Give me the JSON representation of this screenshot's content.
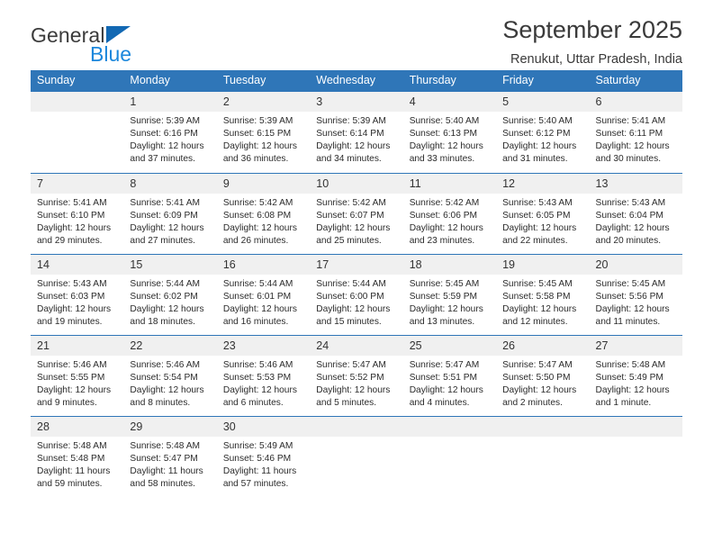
{
  "brand": {
    "name_part1": "General",
    "name_part2": "Blue"
  },
  "header": {
    "title": "September 2025",
    "subtitle": "Renukut, Uttar Pradesh, India"
  },
  "colors": {
    "header_blue": "#2f76b8",
    "brand_blue": "#1b87dc",
    "triangle_blue": "#1268b3",
    "daynum_band": "#f0f0f0",
    "text": "#2b2b2b"
  },
  "weekday_headers": [
    "Sunday",
    "Monday",
    "Tuesday",
    "Wednesday",
    "Thursday",
    "Friday",
    "Saturday"
  ],
  "labels": {
    "sunrise_prefix": "Sunrise:",
    "sunset_prefix": "Sunset:",
    "daylight_prefix": "Daylight:"
  },
  "weeks": [
    [
      {
        "day": "",
        "sunrise": "",
        "sunset": "",
        "daylight_line1": "",
        "daylight_line2": ""
      },
      {
        "day": "1",
        "sunrise": "Sunrise: 5:39 AM",
        "sunset": "Sunset: 6:16 PM",
        "daylight_line1": "Daylight: 12 hours",
        "daylight_line2": "and 37 minutes."
      },
      {
        "day": "2",
        "sunrise": "Sunrise: 5:39 AM",
        "sunset": "Sunset: 6:15 PM",
        "daylight_line1": "Daylight: 12 hours",
        "daylight_line2": "and 36 minutes."
      },
      {
        "day": "3",
        "sunrise": "Sunrise: 5:39 AM",
        "sunset": "Sunset: 6:14 PM",
        "daylight_line1": "Daylight: 12 hours",
        "daylight_line2": "and 34 minutes."
      },
      {
        "day": "4",
        "sunrise": "Sunrise: 5:40 AM",
        "sunset": "Sunset: 6:13 PM",
        "daylight_line1": "Daylight: 12 hours",
        "daylight_line2": "and 33 minutes."
      },
      {
        "day": "5",
        "sunrise": "Sunrise: 5:40 AM",
        "sunset": "Sunset: 6:12 PM",
        "daylight_line1": "Daylight: 12 hours",
        "daylight_line2": "and 31 minutes."
      },
      {
        "day": "6",
        "sunrise": "Sunrise: 5:41 AM",
        "sunset": "Sunset: 6:11 PM",
        "daylight_line1": "Daylight: 12 hours",
        "daylight_line2": "and 30 minutes."
      }
    ],
    [
      {
        "day": "7",
        "sunrise": "Sunrise: 5:41 AM",
        "sunset": "Sunset: 6:10 PM",
        "daylight_line1": "Daylight: 12 hours",
        "daylight_line2": "and 29 minutes."
      },
      {
        "day": "8",
        "sunrise": "Sunrise: 5:41 AM",
        "sunset": "Sunset: 6:09 PM",
        "daylight_line1": "Daylight: 12 hours",
        "daylight_line2": "and 27 minutes."
      },
      {
        "day": "9",
        "sunrise": "Sunrise: 5:42 AM",
        "sunset": "Sunset: 6:08 PM",
        "daylight_line1": "Daylight: 12 hours",
        "daylight_line2": "and 26 minutes."
      },
      {
        "day": "10",
        "sunrise": "Sunrise: 5:42 AM",
        "sunset": "Sunset: 6:07 PM",
        "daylight_line1": "Daylight: 12 hours",
        "daylight_line2": "and 25 minutes."
      },
      {
        "day": "11",
        "sunrise": "Sunrise: 5:42 AM",
        "sunset": "Sunset: 6:06 PM",
        "daylight_line1": "Daylight: 12 hours",
        "daylight_line2": "and 23 minutes."
      },
      {
        "day": "12",
        "sunrise": "Sunrise: 5:43 AM",
        "sunset": "Sunset: 6:05 PM",
        "daylight_line1": "Daylight: 12 hours",
        "daylight_line2": "and 22 minutes."
      },
      {
        "day": "13",
        "sunrise": "Sunrise: 5:43 AM",
        "sunset": "Sunset: 6:04 PM",
        "daylight_line1": "Daylight: 12 hours",
        "daylight_line2": "and 20 minutes."
      }
    ],
    [
      {
        "day": "14",
        "sunrise": "Sunrise: 5:43 AM",
        "sunset": "Sunset: 6:03 PM",
        "daylight_line1": "Daylight: 12 hours",
        "daylight_line2": "and 19 minutes."
      },
      {
        "day": "15",
        "sunrise": "Sunrise: 5:44 AM",
        "sunset": "Sunset: 6:02 PM",
        "daylight_line1": "Daylight: 12 hours",
        "daylight_line2": "and 18 minutes."
      },
      {
        "day": "16",
        "sunrise": "Sunrise: 5:44 AM",
        "sunset": "Sunset: 6:01 PM",
        "daylight_line1": "Daylight: 12 hours",
        "daylight_line2": "and 16 minutes."
      },
      {
        "day": "17",
        "sunrise": "Sunrise: 5:44 AM",
        "sunset": "Sunset: 6:00 PM",
        "daylight_line1": "Daylight: 12 hours",
        "daylight_line2": "and 15 minutes."
      },
      {
        "day": "18",
        "sunrise": "Sunrise: 5:45 AM",
        "sunset": "Sunset: 5:59 PM",
        "daylight_line1": "Daylight: 12 hours",
        "daylight_line2": "and 13 minutes."
      },
      {
        "day": "19",
        "sunrise": "Sunrise: 5:45 AM",
        "sunset": "Sunset: 5:58 PM",
        "daylight_line1": "Daylight: 12 hours",
        "daylight_line2": "and 12 minutes."
      },
      {
        "day": "20",
        "sunrise": "Sunrise: 5:45 AM",
        "sunset": "Sunset: 5:56 PM",
        "daylight_line1": "Daylight: 12 hours",
        "daylight_line2": "and 11 minutes."
      }
    ],
    [
      {
        "day": "21",
        "sunrise": "Sunrise: 5:46 AM",
        "sunset": "Sunset: 5:55 PM",
        "daylight_line1": "Daylight: 12 hours",
        "daylight_line2": "and 9 minutes."
      },
      {
        "day": "22",
        "sunrise": "Sunrise: 5:46 AM",
        "sunset": "Sunset: 5:54 PM",
        "daylight_line1": "Daylight: 12 hours",
        "daylight_line2": "and 8 minutes."
      },
      {
        "day": "23",
        "sunrise": "Sunrise: 5:46 AM",
        "sunset": "Sunset: 5:53 PM",
        "daylight_line1": "Daylight: 12 hours",
        "daylight_line2": "and 6 minutes."
      },
      {
        "day": "24",
        "sunrise": "Sunrise: 5:47 AM",
        "sunset": "Sunset: 5:52 PM",
        "daylight_line1": "Daylight: 12 hours",
        "daylight_line2": "and 5 minutes."
      },
      {
        "day": "25",
        "sunrise": "Sunrise: 5:47 AM",
        "sunset": "Sunset: 5:51 PM",
        "daylight_line1": "Daylight: 12 hours",
        "daylight_line2": "and 4 minutes."
      },
      {
        "day": "26",
        "sunrise": "Sunrise: 5:47 AM",
        "sunset": "Sunset: 5:50 PM",
        "daylight_line1": "Daylight: 12 hours",
        "daylight_line2": "and 2 minutes."
      },
      {
        "day": "27",
        "sunrise": "Sunrise: 5:48 AM",
        "sunset": "Sunset: 5:49 PM",
        "daylight_line1": "Daylight: 12 hours",
        "daylight_line2": "and 1 minute."
      }
    ],
    [
      {
        "day": "28",
        "sunrise": "Sunrise: 5:48 AM",
        "sunset": "Sunset: 5:48 PM",
        "daylight_line1": "Daylight: 11 hours",
        "daylight_line2": "and 59 minutes."
      },
      {
        "day": "29",
        "sunrise": "Sunrise: 5:48 AM",
        "sunset": "Sunset: 5:47 PM",
        "daylight_line1": "Daylight: 11 hours",
        "daylight_line2": "and 58 minutes."
      },
      {
        "day": "30",
        "sunrise": "Sunrise: 5:49 AM",
        "sunset": "Sunset: 5:46 PM",
        "daylight_line1": "Daylight: 11 hours",
        "daylight_line2": "and 57 minutes."
      },
      {
        "day": "",
        "sunrise": "",
        "sunset": "",
        "daylight_line1": "",
        "daylight_line2": ""
      },
      {
        "day": "",
        "sunrise": "",
        "sunset": "",
        "daylight_line1": "",
        "daylight_line2": ""
      },
      {
        "day": "",
        "sunrise": "",
        "sunset": "",
        "daylight_line1": "",
        "daylight_line2": ""
      },
      {
        "day": "",
        "sunrise": "",
        "sunset": "",
        "daylight_line1": "",
        "daylight_line2": ""
      }
    ]
  ]
}
